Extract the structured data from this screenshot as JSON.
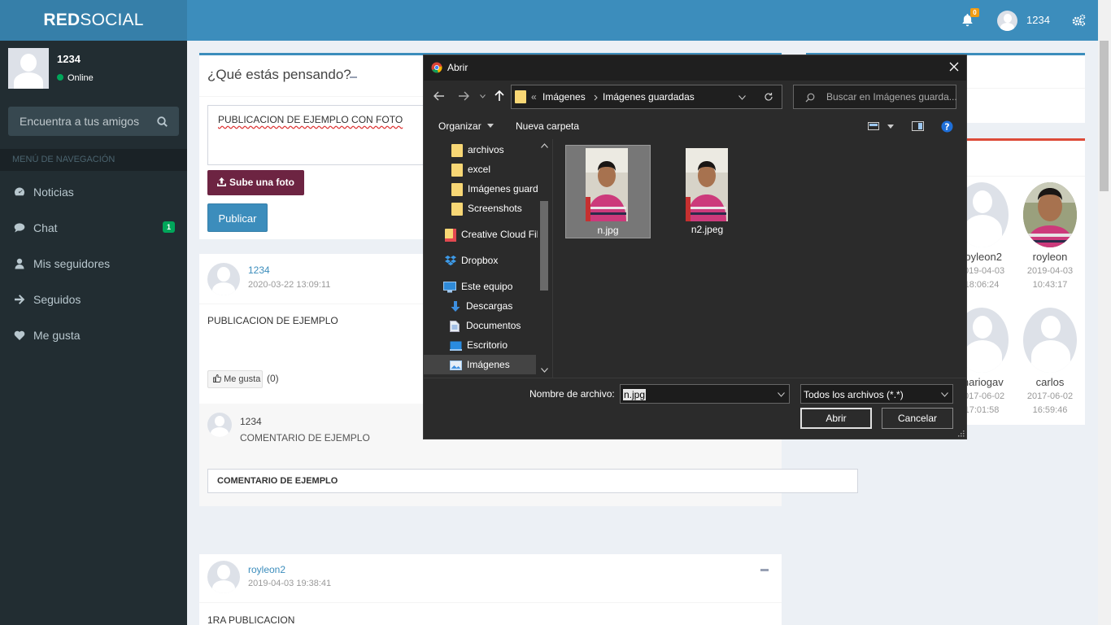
{
  "brand": {
    "part1": "RED",
    "part2": "SOCIAL"
  },
  "topbar": {
    "notifications_count": "0",
    "username": "1234"
  },
  "sidebar": {
    "user_name": "1234",
    "status": "Online",
    "search_placeholder": "Encuentra a tus amigos",
    "nav_header": "MENÚ DE NAVEGACIÓN",
    "items": [
      {
        "label": "Noticias",
        "icon": "dashboard-icon"
      },
      {
        "label": "Chat",
        "icon": "chat-icon",
        "badge": "1"
      },
      {
        "label": "Mis seguidores",
        "icon": "user-icon"
      },
      {
        "label": "Seguidos",
        "icon": "arrow-right-icon"
      },
      {
        "label": "Me gusta",
        "icon": "heart-icon"
      }
    ]
  },
  "compose": {
    "title": "¿Qué estás pensando?",
    "text": "PUBLICACION DE EJEMPLO CON FOTO",
    "upload_label": "Sube una foto",
    "publish_label": "Publicar"
  },
  "posts": [
    {
      "author": "1234",
      "date": "2020-03-22 13:09:11",
      "body": "PUBLICACION DE EJEMPLO",
      "like_label": "Me gusta",
      "like_count": "(0)",
      "comment_author": "1234",
      "comment_text": "COMENTARIO DE EJEMPLO",
      "comment_input": "COMENTARIO DE EJEMPLO"
    },
    {
      "author": "royleon2",
      "date": "2019-04-03 19:38:41",
      "body": "1RA PUBLICACION"
    }
  ],
  "users": [
    {
      "name": "royleon2",
      "date": "2019-04-03",
      "time": "18:06:24"
    },
    {
      "name": "royleon",
      "date": "2019-04-03",
      "time": "10:43:17"
    },
    {
      "name": "mariogav",
      "date": "2017-06-02",
      "time": "17:01:58"
    },
    {
      "name": "carlos",
      "date": "2017-06-02",
      "time": "16:59:46"
    }
  ],
  "dialog": {
    "title": "Abrir",
    "breadcrumb": [
      "Imágenes",
      "Imágenes guardadas"
    ],
    "breadcrumb_prefix": "«",
    "search_placeholder": "Buscar en Imágenes guarda...",
    "organize_label": "Organizar",
    "new_folder_label": "Nueva carpeta",
    "tree": [
      {
        "label": "archivos",
        "icon": "folder-icon"
      },
      {
        "label": "excel",
        "icon": "folder-icon"
      },
      {
        "label": "Imágenes guard",
        "icon": "folder-icon"
      },
      {
        "label": "Screenshots",
        "icon": "folder-icon"
      },
      {
        "label": "Creative Cloud Fil",
        "icon": "creative-cloud-icon"
      },
      {
        "label": "Dropbox",
        "icon": "dropbox-icon"
      },
      {
        "label": "Este equipo",
        "icon": "computer-icon"
      },
      {
        "label": "Descargas",
        "icon": "download-icon"
      },
      {
        "label": "Documentos",
        "icon": "document-icon"
      },
      {
        "label": "Escritorio",
        "icon": "desktop-icon"
      },
      {
        "label": "Imágenes",
        "icon": "pictures-icon"
      }
    ],
    "files": [
      {
        "name": "n.jpg",
        "selected": true
      },
      {
        "name": "n2.jpeg",
        "selected": false
      }
    ],
    "filename_label": "Nombre de archivo:",
    "filename_value": "n.jpg",
    "filetype_value": "Todos los archivos (*.*)",
    "open_label": "Abrir",
    "cancel_label": "Cancelar"
  }
}
